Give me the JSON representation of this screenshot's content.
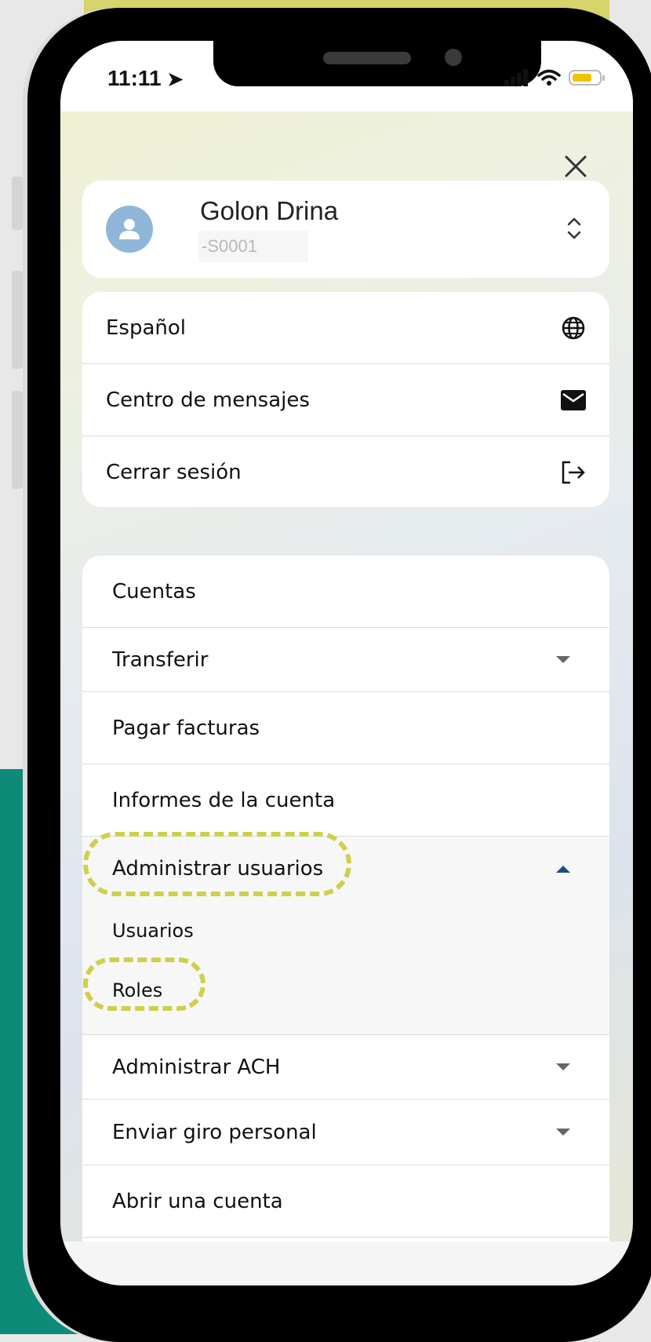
{
  "status": {
    "time": "11:11"
  },
  "profile": {
    "name": "Golon Drina",
    "id": "-S0001"
  },
  "quick_actions": [
    {
      "label": "Español",
      "icon": "globe-icon"
    },
    {
      "label": "Centro de mensajes",
      "icon": "mail-icon"
    },
    {
      "label": "Cerrar sesión",
      "icon": "logout-icon"
    }
  ],
  "menu": {
    "accounts": "Cuentas",
    "transfer": "Transferir",
    "pay_bills": "Pagar facturas",
    "reports": "Informes de la cuenta",
    "manage_users": "Administrar usuarios",
    "users": "Usuarios",
    "roles": "Roles",
    "manage_ach": "Administrar ACH",
    "wire": "Enviar giro personal",
    "open_account": "Abrir una cuenta"
  },
  "colors": {
    "highlight": "#cfcf4e",
    "teal": "#0e8a78",
    "accent": "#1f4a82",
    "avatar": "#8fb6d8"
  }
}
